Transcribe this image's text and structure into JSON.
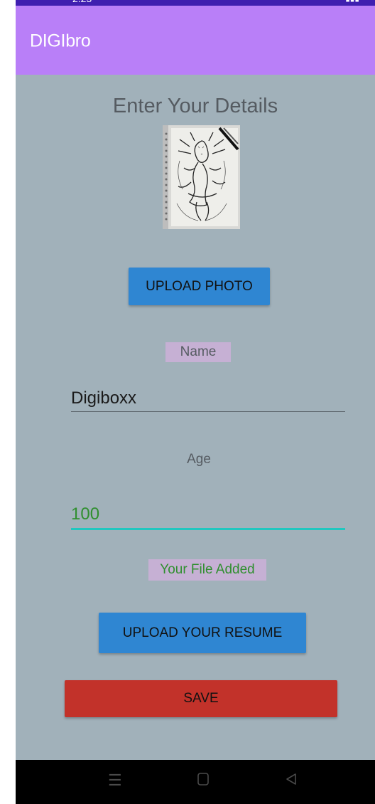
{
  "app": {
    "title": "DIGIbro"
  },
  "form": {
    "heading": "Enter Your Details",
    "upload_photo_label": "UPLOAD PHOTO",
    "name_label": "Name",
    "name_value": "Digiboxx",
    "age_label": "Age",
    "age_value": "100",
    "file_status": "Your File Added",
    "upload_resume_label": "UPLOAD YOUR RESUME",
    "save_label": "SAVE"
  },
  "colors": {
    "app_bar": "#b97ff8",
    "status_bar": "#3f1fb0",
    "background": "#a1b1ba",
    "button_primary": "#2f86d2",
    "button_save": "#c2322a",
    "chip_bg": "#c6b0d4",
    "age_accent": "#20c7bf",
    "success_text": "#2f8f2f"
  },
  "nav": {
    "icons": [
      "menu-icon",
      "home-icon",
      "back-icon"
    ]
  }
}
